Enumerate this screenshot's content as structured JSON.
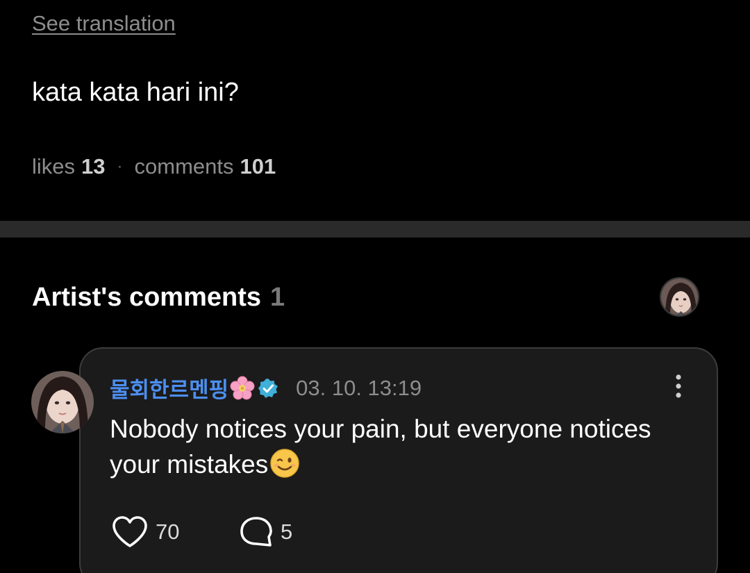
{
  "post": {
    "see_translation": "See translation",
    "text": "kata kata hari ini?",
    "likes_label": "likes",
    "likes_count": "13",
    "separator": "·",
    "comments_label": "comments",
    "comments_count": "101"
  },
  "artist_comments": {
    "title": "Artist's comments",
    "count": "1",
    "comment": {
      "author": "물회한르멘핑",
      "timestamp": "03. 10. 13:19",
      "text": "Nobody notices your pain, but everyone notices your mistakes",
      "likes": "70",
      "replies": "5"
    }
  },
  "colors": {
    "background": "#000000",
    "divider": "#2a2a2a",
    "card": "#1b1b1b",
    "author_name": "#4c8ff0",
    "verified_badge": "#3fb0d8",
    "muted_text": "#8d8d8d"
  },
  "icons": {
    "flower": "cherry-blossom-emoji",
    "verified": "verified-badge-icon",
    "emoji": "winking-face-emoji",
    "more": "more-vertical-icon",
    "like": "heart-outline-icon",
    "reply": "speech-bubble-icon"
  }
}
